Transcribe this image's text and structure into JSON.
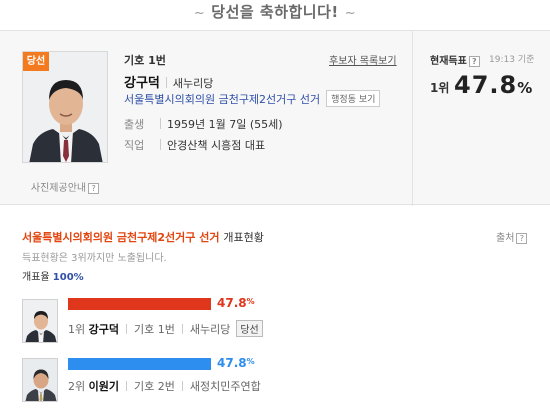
{
  "banner": {
    "left_deco": "~",
    "text": "당선을 축하합니다!",
    "right_deco": "~"
  },
  "winner": {
    "badge": "당선",
    "candidate_no": "기호 1번",
    "list_link": "후보자 목록보기",
    "name": "강구덕",
    "party": "새누리당",
    "district": "서울특별시의회의원 금천구제2선거구 선거",
    "district_button": "행정동 보기",
    "photo_credit": "사진제공안내",
    "help": "?",
    "details": [
      {
        "label": "출생",
        "value": "1959년 1월 7일 (55세)"
      },
      {
        "label": "직업",
        "value": "안경산책 시흥점 대표"
      }
    ]
  },
  "current": {
    "label": "현재득표",
    "help": "?",
    "time": "19:13 기준",
    "rank": "1위",
    "percent_main": "47.8",
    "percent_unit": "%"
  },
  "results": {
    "title": "서울특별시의회의원 금천구제2선거구 선거",
    "title_suffix": "개표현황",
    "source": "출처",
    "help": "?",
    "notice": "득표현황은 3위까지만 노출됩니다.",
    "rate_label": "개표율",
    "rate_value": "100%",
    "candidates": [
      {
        "rank": "1위",
        "name": "강구덕",
        "number": "기호 1번",
        "party": "새누리당",
        "elected": "당선",
        "pct": "47.8",
        "unit": "%",
        "fraction": 0.478,
        "color": "#e0361c"
      },
      {
        "rank": "2위",
        "name": "이원기",
        "number": "기호 2번",
        "party": "새정치민주연합",
        "elected": "",
        "pct": "47.8",
        "unit": "%",
        "fraction": 0.478,
        "color": "#2d8ef0"
      }
    ]
  },
  "colors": {
    "accent_orange": "#f47a20",
    "link_blue": "#2f4fa8",
    "title_red": "#e2450f",
    "bar_red": "#e0361c",
    "bar_blue": "#2d8ef0"
  }
}
